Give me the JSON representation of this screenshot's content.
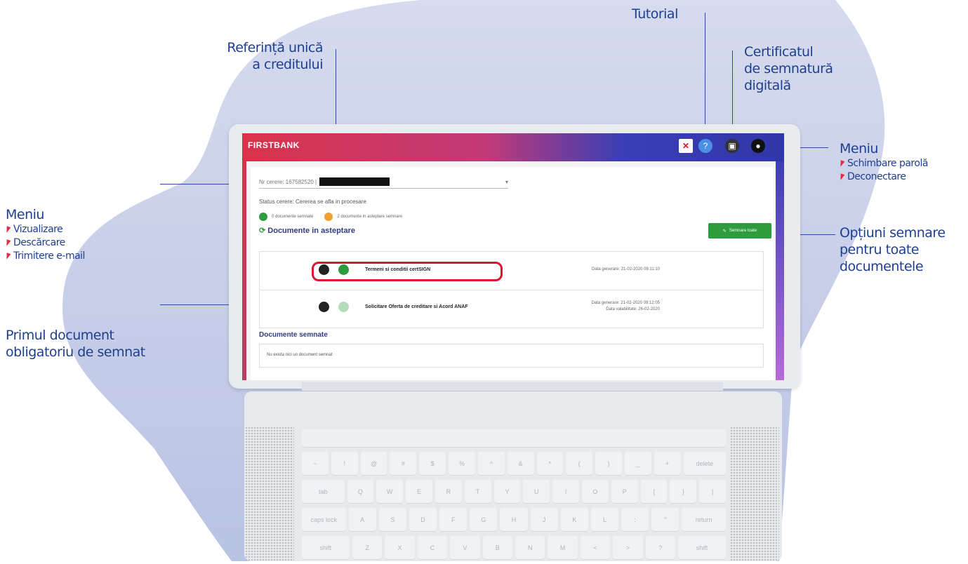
{
  "annotations": {
    "tutorial": "Tutorial",
    "reference_line1": "Referință unică",
    "reference_line2": "a creditului",
    "certificate_line1": "Certificatul",
    "certificate_line2": "de semnatură",
    "certificate_line3": "digitală",
    "menu_top": {
      "title": "Meniu",
      "items": [
        "Schimbare parolă",
        "Deconectare"
      ]
    },
    "sign_all_line1": "Opțiuni semnare",
    "sign_all_line2": "pentru toate",
    "sign_all_line3": "documentele",
    "menu_left": {
      "title": "Meniu",
      "items": [
        "Vizualizare",
        "Descărcare",
        "Trimitere e-mail"
      ]
    },
    "first_doc_line1": "Primul document",
    "first_doc_line2": "obligatoriu de semnat"
  },
  "app": {
    "logo": "FIRSTBANK",
    "request_label": "Nr cerere: 167582520 |",
    "status": "Status cerere: Cererea se afla in procesare",
    "signed_count": "0 documente semnate",
    "pending_count": "2 documente in asteptare semnare",
    "pending_title": "Documente in asteptare",
    "sign_all_button": "Semnare toate",
    "documents": [
      {
        "name": "Termeni si conditii certSIGN",
        "date": "Data generare: 21-02-2020 09:11:10",
        "validity": ""
      },
      {
        "name": "Solicitare Oferta de creditare si Acord ANAF",
        "date": "Data generare: 21-02-2020 09:12:05",
        "validity": "Data valabilitate: 26-02-2020"
      }
    ],
    "signed_title": "Documente semnate",
    "no_signed": "Nu exista nici un document semnat"
  },
  "keyboard": {
    "row1": [
      "~",
      "!",
      "@",
      "#",
      "$",
      "%",
      "^",
      "&",
      "*",
      "(",
      ")",
      "_",
      "+",
      "delete"
    ],
    "row2": [
      "tab",
      "Q",
      "W",
      "E",
      "R",
      "T",
      "Y",
      "U",
      "I",
      "O",
      "P",
      "{",
      "}",
      "|"
    ],
    "row3": [
      "caps lock",
      "A",
      "S",
      "D",
      "F",
      "G",
      "H",
      "J",
      "K",
      "L",
      ":",
      "\"",
      "return"
    ],
    "row4": [
      "shift",
      "Z",
      "X",
      "C",
      "V",
      "B",
      "N",
      "M",
      "<",
      ">",
      "?",
      "shift"
    ]
  },
  "colors": {
    "accent": "#1f3f8f",
    "bullet": "#e32b3c",
    "green": "#2d9c3c",
    "orange": "#f0a030",
    "highlight": "#e01530"
  }
}
